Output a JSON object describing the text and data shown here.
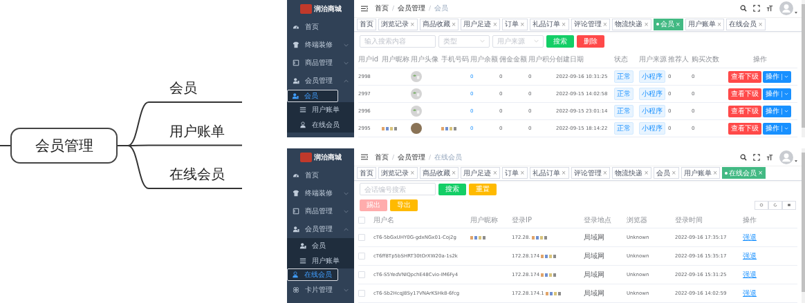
{
  "mindmap": {
    "root": "会员管理",
    "branches": [
      "会员",
      "用户账单",
      "在线会员"
    ]
  },
  "member_screen": {
    "brand": "润治商城",
    "sidebar": [
      {
        "kind": "link",
        "label": "首页"
      },
      {
        "kind": "group",
        "label": "终端装修",
        "expanded": false
      },
      {
        "kind": "group",
        "label": "商品管理",
        "expanded": false
      },
      {
        "kind": "group",
        "label": "会员管理",
        "expanded": true,
        "children": [
          {
            "label": "会员",
            "selected": true
          },
          {
            "label": "用户账单",
            "selected": false
          },
          {
            "label": "在线会员",
            "selected": false
          }
        ]
      }
    ],
    "breadcrumb": {
      "separator": "/",
      "items": [
        "首页",
        "会员管理",
        "会员"
      ]
    },
    "tabs": [
      {
        "label": "首页",
        "selected": false
      },
      {
        "label": "浏览记录",
        "close": "×",
        "selected": false
      },
      {
        "label": "商品收藏",
        "close": "×",
        "selected": false
      },
      {
        "label": "用户足迹",
        "close": "×",
        "selected": false
      },
      {
        "label": "订单",
        "close": "×",
        "selected": false
      },
      {
        "label": "礼品订单",
        "close": "×",
        "selected": false
      },
      {
        "label": "评论管理",
        "close": "×",
        "selected": false
      },
      {
        "label": "物流快递",
        "close": "×",
        "selected": false
      },
      {
        "label": "会员",
        "close": "×",
        "selected": true
      },
      {
        "label": "用户账单",
        "close": "×",
        "selected": false
      },
      {
        "label": "在线会员",
        "close": "×",
        "selected": false
      }
    ],
    "search": {
      "placeholder": "输入搜索内容"
    },
    "selects": [
      {
        "placeholder": "类型"
      },
      {
        "placeholder": "用户来源"
      }
    ],
    "buttons": [
      {
        "label": "搜索",
        "kind": "success"
      },
      {
        "label": "删除",
        "kind": "danger"
      }
    ],
    "columns": [
      "用户id",
      "用户昵称",
      "用户头像",
      "手机号码",
      "用户余额",
      "佣金金额",
      "用户积分",
      "创建日期",
      "状态",
      "用户来源",
      "推荐人",
      "购买次数",
      "操作"
    ],
    "rows": [
      {
        "id": "2998",
        "nickname_redacted": false,
        "avatar": {
          "kind": "broken-image"
        },
        "phone_redacted": false,
        "balance": "0",
        "commission": "0",
        "points": "0",
        "created": "2022-09-16 10:31:25",
        "status": "正常",
        "source": "小程序",
        "referrer": "0",
        "purchases": "0",
        "view_button": "查看下级",
        "action_button": "操作"
      },
      {
        "id": "2997",
        "nickname_redacted": false,
        "avatar": {
          "kind": "broken-image"
        },
        "phone_redacted": false,
        "balance": "0",
        "commission": "0",
        "points": "0",
        "created": "2022-09-15 14:02:58",
        "status": "正常",
        "source": "小程序",
        "referrer": "0",
        "purchases": "0",
        "view_button": "查看下级",
        "action_button": "操作"
      },
      {
        "id": "2996",
        "nickname_redacted": false,
        "avatar": {
          "kind": "broken-image"
        },
        "phone_redacted": false,
        "balance": "0",
        "commission": "0",
        "points": "0",
        "created": "2022-09-15 23:01:14",
        "status": "正常",
        "source": "小程序",
        "referrer": "0",
        "purchases": "0",
        "view_button": "查看下级",
        "action_button": "操作"
      },
      {
        "id": "2995",
        "nickname_redacted": true,
        "avatar": {
          "kind": "photo"
        },
        "phone_redacted": true,
        "balance": "0",
        "commission": "0",
        "points": "0",
        "created": "2022-09-15 18:14:22",
        "status": "正常",
        "source": "小程序",
        "referrer": "0",
        "purchases": "0",
        "view_button": "查看下级",
        "action_button": "操作"
      }
    ]
  },
  "online_screen": {
    "brand": "润治商城",
    "sidebar": [
      {
        "kind": "link",
        "label": "首页"
      },
      {
        "kind": "group",
        "label": "终端装修",
        "expanded": false
      },
      {
        "kind": "group",
        "label": "商品管理",
        "expanded": false
      },
      {
        "kind": "group",
        "label": "会员管理",
        "expanded": true,
        "children": [
          {
            "label": "会员",
            "selected": false
          },
          {
            "label": "用户账单",
            "selected": false
          },
          {
            "label": "在线会员",
            "selected": true
          }
        ]
      },
      {
        "kind": "group",
        "label": "卡片管理",
        "expanded": false
      }
    ],
    "breadcrumb": {
      "separator": "/",
      "items": [
        "首页",
        "会员管理",
        "在线会员"
      ]
    },
    "tabs": [
      {
        "label": "首页",
        "selected": false
      },
      {
        "label": "浏览记录",
        "close": "×",
        "selected": false
      },
      {
        "label": "商品收藏",
        "close": "×",
        "selected": false
      },
      {
        "label": "用户足迹",
        "close": "×",
        "selected": false
      },
      {
        "label": "订单",
        "close": "×",
        "selected": false
      },
      {
        "label": "礼品订单",
        "close": "×",
        "selected": false
      },
      {
        "label": "评论管理",
        "close": "×",
        "selected": false
      },
      {
        "label": "物流快递",
        "close": "×",
        "selected": false
      },
      {
        "label": "会员",
        "close": "×",
        "selected": false
      },
      {
        "label": "用户账单",
        "close": "×",
        "selected": false
      },
      {
        "label": "在线会员",
        "close": "×",
        "selected": true
      }
    ],
    "search": {
      "placeholder": "会话编号搜索"
    },
    "select_all_checked": false,
    "buttons": [
      {
        "label": "搜索",
        "kind": "success",
        "disabled": false
      },
      {
        "label": "重置",
        "kind": "warning",
        "disabled": false
      }
    ],
    "actions": [
      {
        "label": "踢出",
        "kind": "danger",
        "disabled": true
      },
      {
        "label": "导出",
        "kind": "warning",
        "disabled": false
      }
    ],
    "columns": [
      "用户名",
      "用户昵称",
      "登录IP",
      "登录地点",
      "浏览器",
      "登录时间",
      "操作"
    ],
    "rows": [
      {
        "checked": false,
        "username": "cT6-5bGxUHY0G-gdxNGx01-Coj2g",
        "nickname_redacted": true,
        "ip": "172.28.",
        "ip_redacted": true,
        "location": "局域网",
        "browser": "Unknown",
        "time": "2022-09-16 17:35:17",
        "action": "强退"
      },
      {
        "checked": false,
        "username": "cT6ff8Tp5bSHRT30tOrXW20a-1s2k",
        "nickname_redacted": false,
        "ip": "172.28.174",
        "ip_redacted": true,
        "location": "局域网",
        "browser": "Unknown",
        "time": "2022-09-16 15:35:17",
        "action": "强退"
      },
      {
        "checked": false,
        "username": "cT6-S5YedVNIQpchE48Cvio-IM6Fy4",
        "nickname_redacted": false,
        "ip": "172.28.174",
        "ip_redacted": true,
        "location": "局域网",
        "browser": "Unknown",
        "time": "2022-09-16 15:31:25",
        "action": "强退"
      },
      {
        "checked": false,
        "username": "cT6-Sb2HcqJ8Sy17VNArKSHk8-6fcg",
        "nickname_redacted": false,
        "ip": "172.28.174.1",
        "ip_redacted": true,
        "location": "局域网",
        "browser": "Unknown",
        "time": "2022-09-16 14:02:59",
        "action": "强退"
      }
    ]
  }
}
